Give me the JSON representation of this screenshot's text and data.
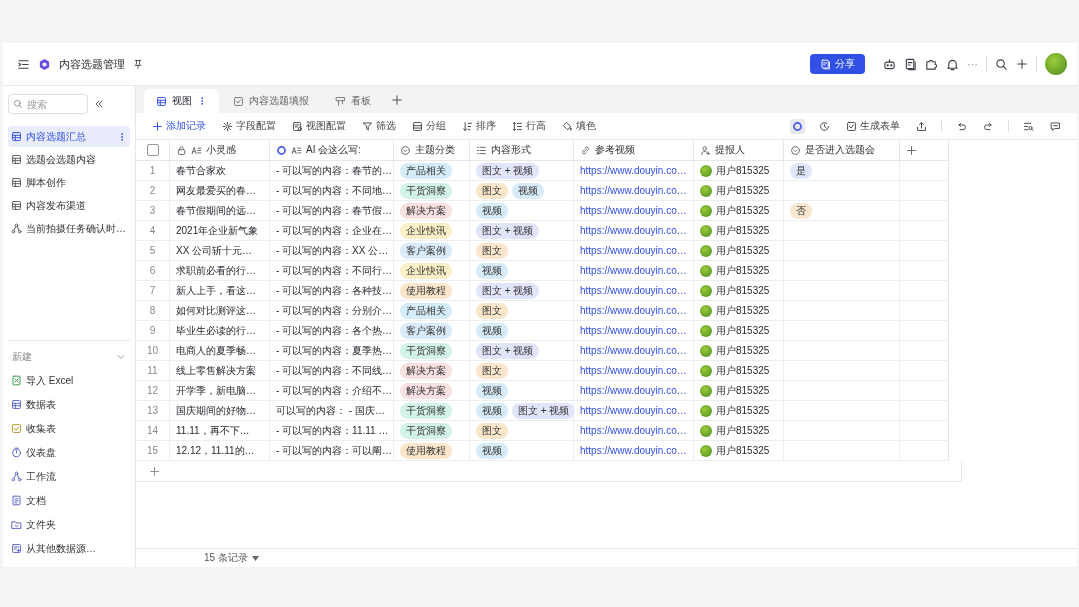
{
  "header": {
    "title": "内容选题管理",
    "share_label": "分享",
    "more": "···"
  },
  "sidebar": {
    "search_placeholder": "搜索",
    "tables": [
      {
        "label": "内容选题汇总",
        "kind": "table",
        "selected": true
      },
      {
        "label": "选题会选题内容",
        "kind": "table",
        "selected": false
      },
      {
        "label": "脚本创作",
        "kind": "table",
        "selected": false
      },
      {
        "label": "内容发布渠道",
        "kind": "table",
        "selected": false
      },
      {
        "label": "当前拍摄任务确认时…",
        "kind": "workflow",
        "selected": false
      }
    ],
    "new_section": {
      "label": "新建",
      "items": [
        {
          "label": "导入 Excel",
          "kind": "excel"
        },
        {
          "label": "数据表",
          "kind": "table"
        },
        {
          "label": "收集表",
          "kind": "form"
        },
        {
          "label": "仪表盘",
          "kind": "dashboard"
        },
        {
          "label": "工作流",
          "kind": "workflow"
        },
        {
          "label": "文档",
          "kind": "doc"
        },
        {
          "label": "文件夹",
          "kind": "folder"
        },
        {
          "label": "从其他数据源…",
          "kind": "source"
        }
      ]
    }
  },
  "tabs": [
    {
      "label": "视图",
      "kind": "grid",
      "selected": true
    },
    {
      "label": "内容选题填报",
      "kind": "form",
      "selected": false
    },
    {
      "label": "看板",
      "kind": "kanban",
      "selected": false
    }
  ],
  "toolbar": {
    "left": [
      {
        "label": "添加记录",
        "kind": "add"
      },
      {
        "label": "字段配置",
        "kind": "gear"
      },
      {
        "label": "视图配置",
        "kind": "view"
      },
      {
        "label": "筛选",
        "kind": "filter"
      },
      {
        "label": "分组",
        "kind": "group"
      },
      {
        "label": "排序",
        "kind": "sort"
      },
      {
        "label": "行高",
        "kind": "height"
      },
      {
        "label": "填色",
        "kind": "fill"
      }
    ],
    "right": [
      {
        "kind": "ai",
        "active": true
      },
      {
        "kind": "history",
        "active": false
      },
      {
        "kind": "form",
        "label": "生成表单",
        "active": false
      },
      {
        "kind": "share",
        "active": false
      },
      {
        "kind": "undo",
        "active": false
      },
      {
        "kind": "redo",
        "active": false
      },
      {
        "kind": "find",
        "active": false
      },
      {
        "kind": "comment",
        "active": false
      }
    ]
  },
  "table": {
    "select_all": {
      "checked": false
    },
    "columns": [
      {
        "label": "小灵感",
        "kind": "primary"
      },
      {
        "label": "AI 会这么写:",
        "kind": "ai"
      },
      {
        "label": "主题分类",
        "kind": "select"
      },
      {
        "label": "内容形式",
        "kind": "multi"
      },
      {
        "label": "参考视频",
        "kind": "link"
      },
      {
        "label": "提报人",
        "kind": "person"
      },
      {
        "label": "是否进入选题会",
        "kind": "select"
      }
    ],
    "rows": [
      {
        "num": "1",
        "idea": "春节合家欢",
        "ai": "- 可以写的内容：春节的…",
        "topic": {
          "text": "产品相关",
          "color": "#d5edf9"
        },
        "forms": [
          {
            "text": "图文 + 视频",
            "color": "#e1e5fa"
          }
        ],
        "link": "https://www.douyin.co…",
        "reporter": "用户815325",
        "decision": {
          "text": "是",
          "color": "#e1e7fa"
        }
      },
      {
        "num": "2",
        "idea": "网友最爱买的春…",
        "ai": "- 可以写的内容：不同地…",
        "topic": {
          "text": "干货洞察",
          "color": "#d3f2ea"
        },
        "forms": [
          {
            "text": "图文",
            "color": "#fbe6cc"
          },
          {
            "text": "视频",
            "color": "#d8ebf8"
          }
        ],
        "link": "https://www.douyin.co…",
        "reporter": "用户815325"
      },
      {
        "num": "3",
        "idea": "春节假期间的远…",
        "ai": "- 可以写的内容：春节假…",
        "topic": {
          "text": "解决方案",
          "color": "#f8e1e1"
        },
        "forms": [
          {
            "text": "视频",
            "color": "#d8ebf8"
          }
        ],
        "link": "https://www.douyin.co…",
        "reporter": "用户815325",
        "decision": {
          "text": "否",
          "color": "#f9e7cf"
        }
      },
      {
        "num": "4",
        "idea": "2021年企业新气象",
        "ai": "- 可以写的内容：企业在…",
        "topic": {
          "text": "企业快讯",
          "color": "#faefc7"
        },
        "forms": [
          {
            "text": "图文 + 视频",
            "color": "#e1e5fa"
          }
        ],
        "link": "https://www.douyin.co…",
        "reporter": "用户815325"
      },
      {
        "num": "5",
        "idea": "XX 公司斩十元…",
        "ai": "- 可以写的内容：XX 公…",
        "topic": {
          "text": "客户案例",
          "color": "#d9eaf9"
        },
        "forms": [
          {
            "text": "图文",
            "color": "#fbe6cc"
          }
        ],
        "link": "https://www.douyin.co…",
        "reporter": "用户815325"
      },
      {
        "num": "6",
        "idea": "求职前必看的行…",
        "ai": "- 可以写的内容：不同行…",
        "topic": {
          "text": "企业快讯",
          "color": "#faefc7"
        },
        "forms": [
          {
            "text": "视频",
            "color": "#d8ebf8"
          }
        ],
        "link": "https://www.douyin.co…",
        "reporter": "用户815325"
      },
      {
        "num": "7",
        "idea": "新人上手，看这…",
        "ai": "- 可以写的内容：各种技…",
        "topic": {
          "text": "使用教程",
          "color": "#fbe6cc"
        },
        "forms": [
          {
            "text": "图文 + 视频",
            "color": "#e1e5fa"
          }
        ],
        "link": "https://www.douyin.co…",
        "reporter": "用户815325"
      },
      {
        "num": "8",
        "idea": "如何对比测评这…",
        "ai": "- 可以写的内容：分别介…",
        "topic": {
          "text": "产品相关",
          "color": "#d5edf9"
        },
        "forms": [
          {
            "text": "图文",
            "color": "#fbe6cc"
          }
        ],
        "link": "https://www.douyin.co…",
        "reporter": "用户815325"
      },
      {
        "num": "9",
        "idea": "毕业生必读的行…",
        "ai": "- 可以写的内容：各个热…",
        "topic": {
          "text": "客户案例",
          "color": "#d9eaf9"
        },
        "forms": [
          {
            "text": "视频",
            "color": "#d8ebf8"
          }
        ],
        "link": "https://www.douyin.co…",
        "reporter": "用户815325"
      },
      {
        "num": "10",
        "idea": "电商人的夏季畅…",
        "ai": "- 可以写的内容：夏季热…",
        "topic": {
          "text": "干货洞察",
          "color": "#d3f2ea"
        },
        "forms": [
          {
            "text": "图文 + 视频",
            "color": "#e1e5fa"
          }
        ],
        "link": "https://www.douyin.co…",
        "reporter": "用户815325"
      },
      {
        "num": "11",
        "idea": "线上零售解决方案",
        "ai": "- 可以写的内容：不同线…",
        "topic": {
          "text": "解决方案",
          "color": "#f8e1e1"
        },
        "forms": [
          {
            "text": "图文",
            "color": "#fbe6cc"
          }
        ],
        "link": "https://www.douyin.co…",
        "reporter": "用户815325"
      },
      {
        "num": "12",
        "idea": "开学季，新电脑…",
        "ai": "- 可以写的内容：介绍不…",
        "topic": {
          "text": "解决方案",
          "color": "#f8e1e1"
        },
        "forms": [
          {
            "text": "视频",
            "color": "#d8ebf8"
          }
        ],
        "link": "https://www.douyin.co…",
        "reporter": "用户815325"
      },
      {
        "num": "13",
        "idea": "国庆期间的好物…",
        "ai": "可以写的内容： - 国庆…",
        "topic": {
          "text": "干货洞察",
          "color": "#d3f2ea"
        },
        "forms": [
          {
            "text": "视频",
            "color": "#d8ebf8"
          },
          {
            "text": "图文 + 视频",
            "color": "#e1e5fa"
          }
        ],
        "link": "https://www.douyin.co…",
        "reporter": "用户815325"
      },
      {
        "num": "14",
        "idea": "11.11，再不下…",
        "ai": "- 可以写的内容：11.11 …",
        "topic": {
          "text": "干货洞察",
          "color": "#d3f2ea"
        },
        "forms": [
          {
            "text": "图文",
            "color": "#fbe6cc"
          }
        ],
        "link": "https://www.douyin.co…",
        "reporter": "用户815325"
      },
      {
        "num": "15",
        "idea": "12.12，11.11的…",
        "ai": "- 可以写的内容：可以阐…",
        "topic": {
          "text": "使用教程",
          "color": "#fbe6cc"
        },
        "forms": [
          {
            "text": "视频",
            "color": "#d8ebf8"
          }
        ],
        "link": "https://www.douyin.co…",
        "reporter": "用户815325"
      }
    ]
  },
  "footer": {
    "record_count": "15 条记录"
  }
}
